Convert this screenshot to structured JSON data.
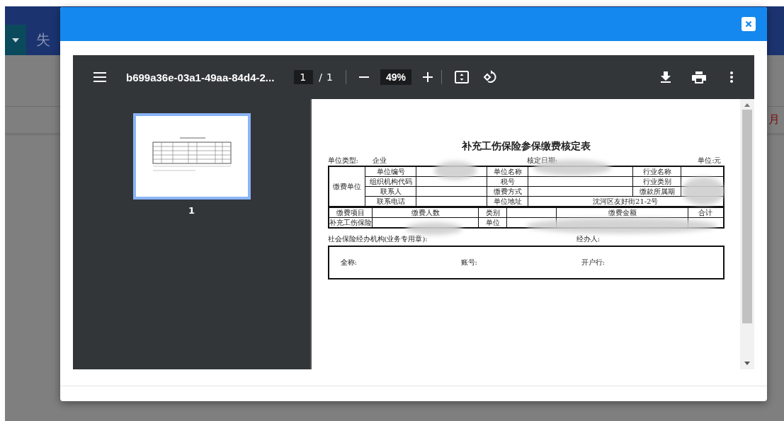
{
  "background": {
    "heading": "失",
    "side_text": "月"
  },
  "viewer": {
    "file_name": "b699a36e-03a1-49aa-84d4-2...",
    "page_current": "1",
    "page_separator": "/",
    "page_total": "1",
    "zoom": "49%",
    "thumbnails": [
      {
        "label": "1",
        "selected": true
      }
    ],
    "document": {
      "title": "补充工伤保险参保缴费核定表",
      "redacted": true,
      "meta": [
        {
          "label": "单位类型:",
          "value": "企业"
        },
        {
          "label": "核定日期:"
        },
        {
          "label": "单位:元"
        }
      ],
      "unit_table": {
        "group_label": "缴费单位",
        "rows": [
          [
            {
              "text": "单位编号"
            },
            {},
            {
              "text": "单位名称"
            },
            {},
            {
              "text": "行业名称"
            },
            {}
          ],
          [
            {
              "text": "组织机构代码"
            },
            {},
            {
              "text": "税号"
            },
            {},
            {
              "text": "行业类别"
            },
            {}
          ],
          [
            {
              "text": "联系人"
            },
            {},
            {
              "text": "缴费方式"
            },
            {},
            {
              "text": "缴款所属期"
            },
            {}
          ],
          [
            {
              "text": "联系电话"
            },
            {},
            {
              "text": "单位地址"
            },
            {
              "text": "沈河区友好街21-2号",
              "colspan": 3
            }
          ]
        ]
      },
      "fee_table": {
        "rows": [
          [
            {
              "text": "缴费项目"
            },
            {
              "text": "缴费人数"
            },
            {
              "text": "类别"
            },
            {},
            {
              "text": "缴费金额"
            },
            {
              "text": "合计"
            }
          ],
          [
            {
              "text": "补充工伤保险"
            },
            {},
            {
              "text": "单位"
            },
            {},
            {},
            {}
          ]
        ]
      },
      "agency": "社会保险经办机构(业务专用章):",
      "handler": "经办人:",
      "bank": [
        {
          "label": "全称:"
        },
        {
          "label": "账号:"
        },
        {
          "label": "开户行:"
        }
      ]
    }
  }
}
